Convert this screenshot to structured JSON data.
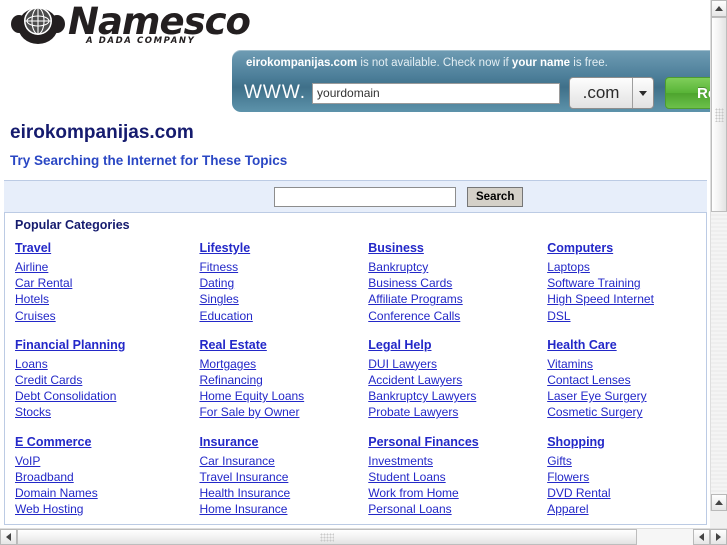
{
  "brand": {
    "name": "Namesco",
    "tagline": "A DADA COMPANY",
    "logo_icon": "globe-monkey-logo-icon"
  },
  "promo": {
    "message_domain": "eirokompanijas.com",
    "message_mid": " is not available. Check now if ",
    "message_bold2": "your name",
    "message_end": " is free.",
    "www_label": "WWW.",
    "domain_input_value": "yourdomain",
    "domain_input_placeholder": "yourdomain",
    "tld_selected": ".com",
    "register_label": "Register",
    "banner_color": "#4d7f9a",
    "register_color": "#58b437"
  },
  "page": {
    "title": "eirokompanijas.com",
    "subtitle": "Try Searching the Internet for These Topics",
    "title_color": "#151b6e",
    "subtitle_color": "#2a47c4"
  },
  "search": {
    "value": "",
    "placeholder": "",
    "button_label": "Search",
    "band_color": "#e7eefa"
  },
  "categories": {
    "heading": "Popular Categories",
    "link_color": "#2328c8",
    "rows": [
      [
        {
          "title": "Travel",
          "links": [
            "Airline",
            "Car Rental",
            "Hotels",
            "Cruises"
          ]
        },
        {
          "title": "Lifestyle",
          "links": [
            "Fitness",
            "Dating",
            "Singles",
            "Education"
          ]
        },
        {
          "title": "Business",
          "links": [
            "Bankruptcy",
            "Business Cards",
            "Affiliate Programs",
            "Conference Calls"
          ]
        },
        {
          "title": "Computers",
          "links": [
            "Laptops",
            "Software Training",
            "High Speed Internet",
            "DSL"
          ]
        }
      ],
      [
        {
          "title": "Financial Planning",
          "links": [
            "Loans",
            "Credit Cards",
            "Debt Consolidation",
            "Stocks"
          ]
        },
        {
          "title": "Real Estate",
          "links": [
            "Mortgages",
            "Refinancing",
            "Home Equity Loans",
            "For Sale by Owner"
          ]
        },
        {
          "title": "Legal Help",
          "links": [
            "DUI Lawyers",
            "Accident Lawyers",
            "Bankruptcy Lawyers",
            "Probate Lawyers"
          ]
        },
        {
          "title": "Health Care",
          "links": [
            "Vitamins",
            "Contact Lenses",
            "Laser Eye Surgery",
            "Cosmetic Surgery"
          ]
        }
      ],
      [
        {
          "title": "E Commerce",
          "links": [
            "VoIP",
            "Broadband",
            "Domain Names",
            "Web Hosting"
          ]
        },
        {
          "title": "Insurance",
          "links": [
            "Car Insurance",
            "Travel Insurance",
            "Health Insurance",
            "Home Insurance"
          ]
        },
        {
          "title": "Personal Finances",
          "links": [
            "Investments",
            "Student Loans",
            "Work from Home",
            "Personal Loans"
          ]
        },
        {
          "title": "Shopping",
          "links": [
            "Gifts",
            "Flowers",
            "DVD Rental",
            "Apparel"
          ]
        }
      ]
    ]
  },
  "scrollbars": {
    "vertical_up_icon": "scroll-up-arrow-icon",
    "vertical_down_icon": "scroll-down-arrow-icon",
    "horizontal_left_icon": "scroll-left-arrow-icon",
    "horizontal_right_icon": "scroll-right-arrow-icon"
  }
}
